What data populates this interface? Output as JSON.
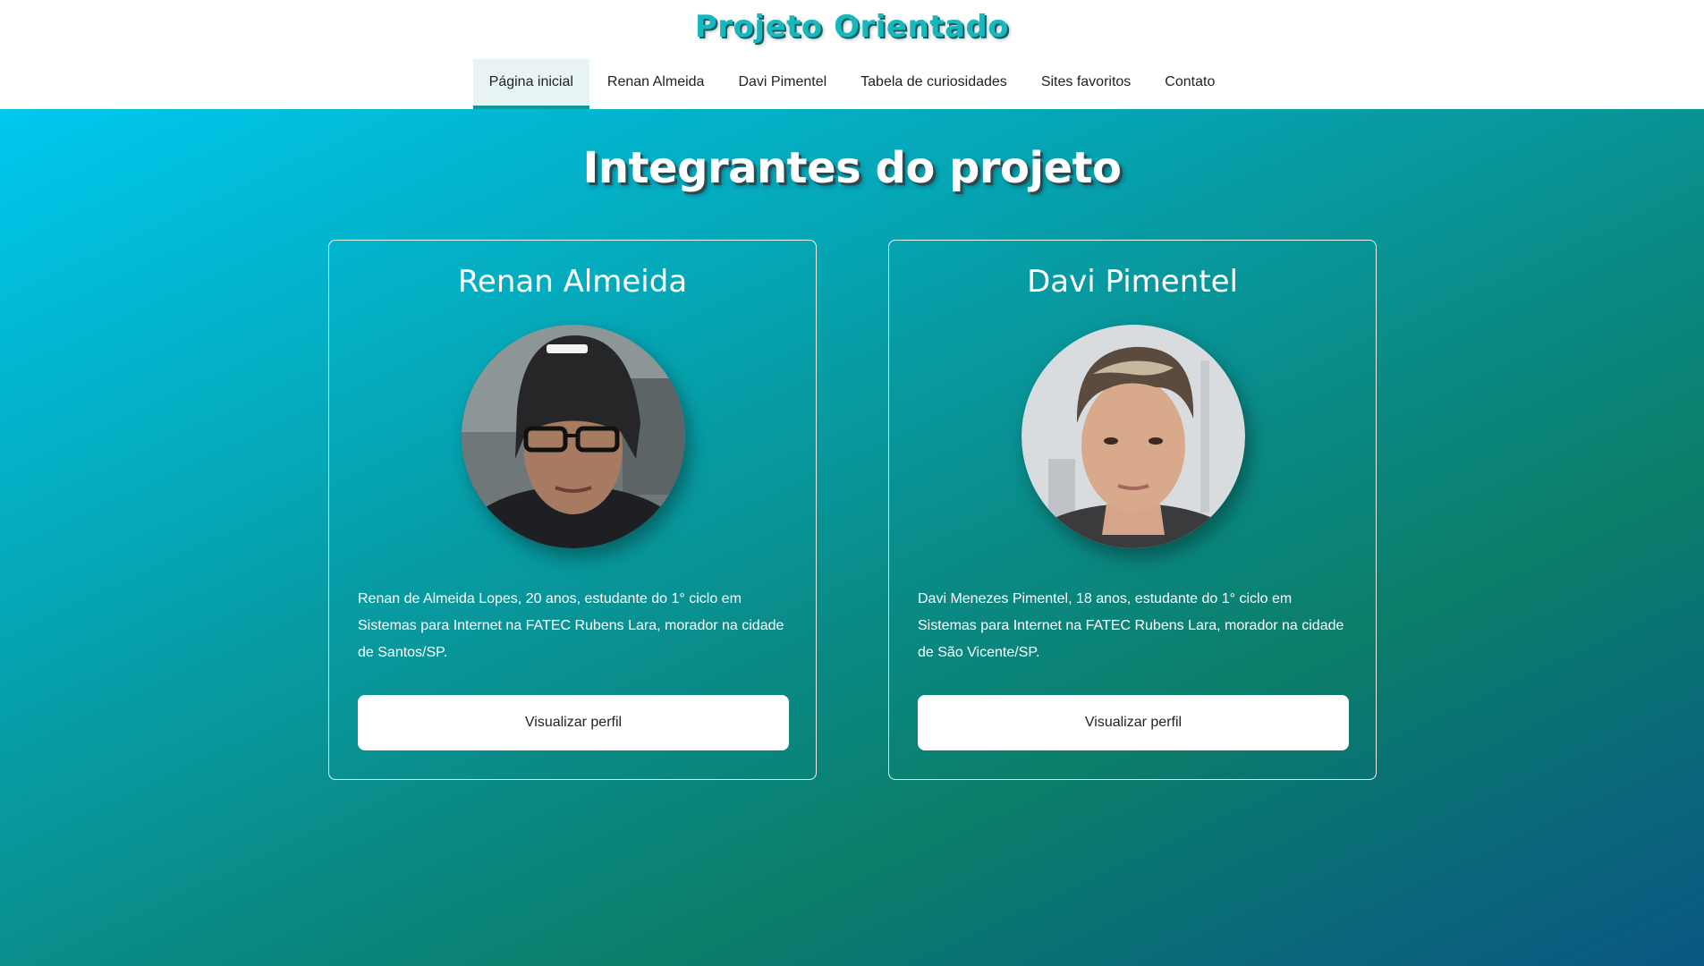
{
  "site": {
    "title": "Projeto Orientado"
  },
  "nav": {
    "items": [
      {
        "label": "Página inicial",
        "active": true
      },
      {
        "label": "Renan Almeida",
        "active": false
      },
      {
        "label": "Davi Pimentel",
        "active": false
      },
      {
        "label": "Tabela de curiosidades",
        "active": false
      },
      {
        "label": "Sites favoritos",
        "active": false
      },
      {
        "label": "Contato",
        "active": false
      }
    ]
  },
  "section": {
    "heading": "Integrantes do projeto"
  },
  "members": [
    {
      "name": "Renan Almeida",
      "photo": "portrait-photo",
      "description": "Renan de Almeida Lopes, 20 anos, estudante do 1° ciclo em Sistemas para Internet na FATEC Rubens Lara, morador na cidade de Santos/SP.",
      "button_label": "Visualizar perfil"
    },
    {
      "name": "Davi Pimentel",
      "photo": "portrait-photo",
      "description": "Davi Menezes Pimentel, 18 anos, estudante do 1° ciclo em Sistemas para Internet na FATEC Rubens Lara, morador na cidade de São Vicente/SP.",
      "button_label": "Visualizar perfil"
    }
  ],
  "colors": {
    "accent": "#16b7bd",
    "nav_active_underline": "#0e9b98",
    "gradient_start": "#00c8ee",
    "gradient_end": "#0a5682"
  }
}
